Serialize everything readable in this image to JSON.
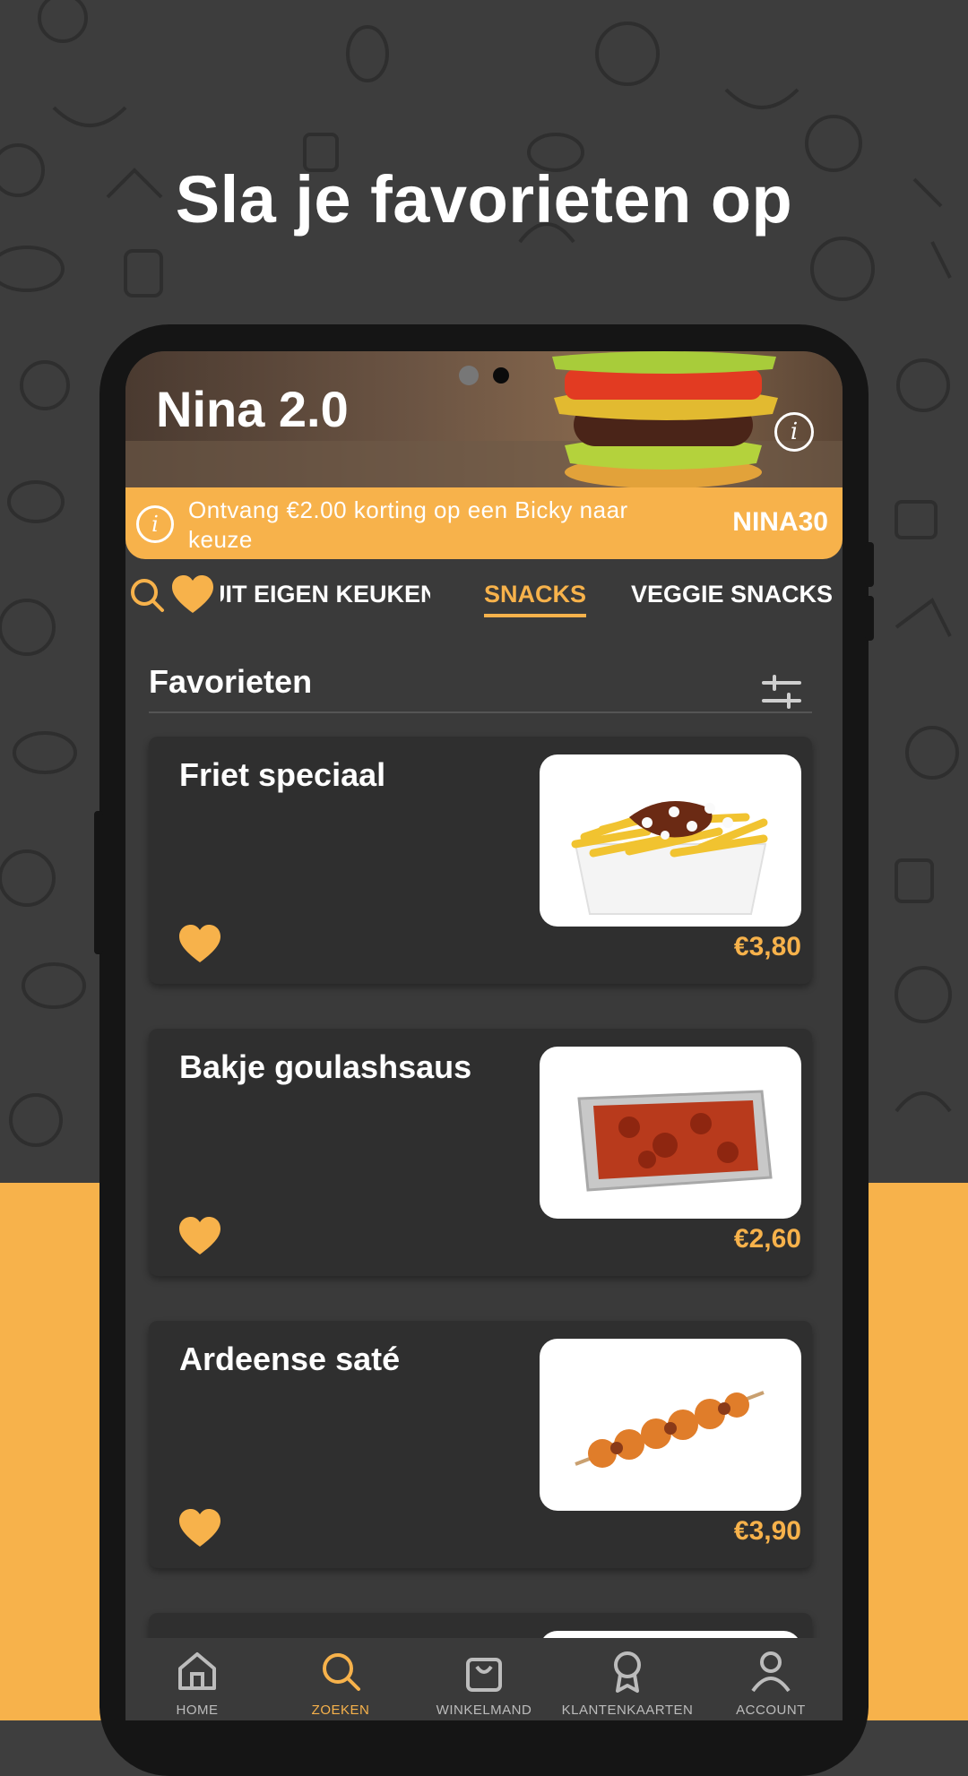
{
  "headline": "Sla je favorieten op",
  "app": {
    "title": "Nina 2.0",
    "promo": {
      "text": "Ontvang €2.00 korting op een Bicky naar keuze",
      "code": "NINA30"
    }
  },
  "tabs": [
    {
      "label": "UIT EIGEN KEUKEN"
    },
    {
      "label": "SNACKS",
      "active": true
    },
    {
      "label": "VEGGIE SNACKS"
    }
  ],
  "section": {
    "title": "Favorieten"
  },
  "items": [
    {
      "name": "Friet speciaal",
      "price": "€3,80"
    },
    {
      "name": "Bakje goulashsaus",
      "price": "€2,60"
    },
    {
      "name": "Ardeense saté",
      "price": "€3,90"
    }
  ],
  "nav": [
    {
      "label": "HOME",
      "icon": "home-icon"
    },
    {
      "label": "ZOEKEN",
      "icon": "search-icon",
      "active": true
    },
    {
      "label": "WINKELMAND",
      "icon": "shopping-bag-icon"
    },
    {
      "label": "KLANTENKAARTEN",
      "icon": "badge-icon"
    },
    {
      "label": "ACCOUNT",
      "icon": "user-icon"
    }
  ],
  "colors": {
    "accent": "#f7b24b",
    "background": "#3d3d3d",
    "card": "#2f2f2f"
  }
}
